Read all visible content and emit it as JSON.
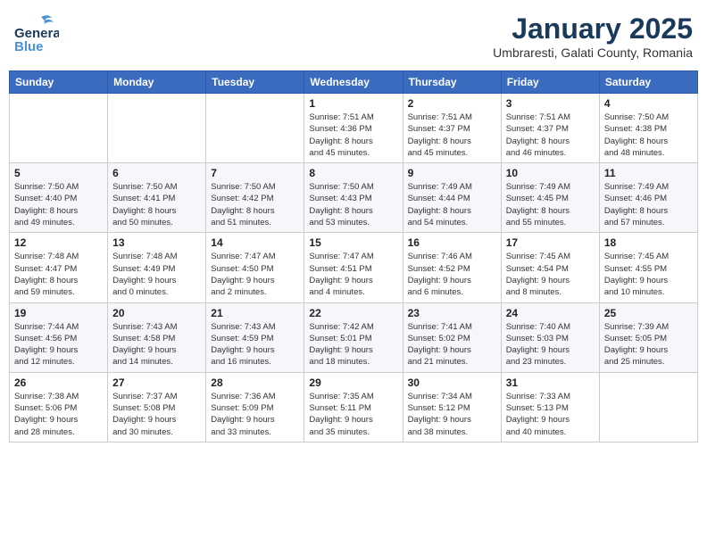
{
  "header": {
    "logo_line1": "General",
    "logo_line2": "Blue",
    "month_title": "January 2025",
    "subtitle": "Umbraresti, Galati County, Romania"
  },
  "weekdays": [
    "Sunday",
    "Monday",
    "Tuesday",
    "Wednesday",
    "Thursday",
    "Friday",
    "Saturday"
  ],
  "weeks": [
    [
      {
        "day": "",
        "info": ""
      },
      {
        "day": "",
        "info": ""
      },
      {
        "day": "",
        "info": ""
      },
      {
        "day": "1",
        "info": "Sunrise: 7:51 AM\nSunset: 4:36 PM\nDaylight: 8 hours\nand 45 minutes."
      },
      {
        "day": "2",
        "info": "Sunrise: 7:51 AM\nSunset: 4:37 PM\nDaylight: 8 hours\nand 45 minutes."
      },
      {
        "day": "3",
        "info": "Sunrise: 7:51 AM\nSunset: 4:37 PM\nDaylight: 8 hours\nand 46 minutes."
      },
      {
        "day": "4",
        "info": "Sunrise: 7:50 AM\nSunset: 4:38 PM\nDaylight: 8 hours\nand 48 minutes."
      }
    ],
    [
      {
        "day": "5",
        "info": "Sunrise: 7:50 AM\nSunset: 4:40 PM\nDaylight: 8 hours\nand 49 minutes."
      },
      {
        "day": "6",
        "info": "Sunrise: 7:50 AM\nSunset: 4:41 PM\nDaylight: 8 hours\nand 50 minutes."
      },
      {
        "day": "7",
        "info": "Sunrise: 7:50 AM\nSunset: 4:42 PM\nDaylight: 8 hours\nand 51 minutes."
      },
      {
        "day": "8",
        "info": "Sunrise: 7:50 AM\nSunset: 4:43 PM\nDaylight: 8 hours\nand 53 minutes."
      },
      {
        "day": "9",
        "info": "Sunrise: 7:49 AM\nSunset: 4:44 PM\nDaylight: 8 hours\nand 54 minutes."
      },
      {
        "day": "10",
        "info": "Sunrise: 7:49 AM\nSunset: 4:45 PM\nDaylight: 8 hours\nand 55 minutes."
      },
      {
        "day": "11",
        "info": "Sunrise: 7:49 AM\nSunset: 4:46 PM\nDaylight: 8 hours\nand 57 minutes."
      }
    ],
    [
      {
        "day": "12",
        "info": "Sunrise: 7:48 AM\nSunset: 4:47 PM\nDaylight: 8 hours\nand 59 minutes."
      },
      {
        "day": "13",
        "info": "Sunrise: 7:48 AM\nSunset: 4:49 PM\nDaylight: 9 hours\nand 0 minutes."
      },
      {
        "day": "14",
        "info": "Sunrise: 7:47 AM\nSunset: 4:50 PM\nDaylight: 9 hours\nand 2 minutes."
      },
      {
        "day": "15",
        "info": "Sunrise: 7:47 AM\nSunset: 4:51 PM\nDaylight: 9 hours\nand 4 minutes."
      },
      {
        "day": "16",
        "info": "Sunrise: 7:46 AM\nSunset: 4:52 PM\nDaylight: 9 hours\nand 6 minutes."
      },
      {
        "day": "17",
        "info": "Sunrise: 7:45 AM\nSunset: 4:54 PM\nDaylight: 9 hours\nand 8 minutes."
      },
      {
        "day": "18",
        "info": "Sunrise: 7:45 AM\nSunset: 4:55 PM\nDaylight: 9 hours\nand 10 minutes."
      }
    ],
    [
      {
        "day": "19",
        "info": "Sunrise: 7:44 AM\nSunset: 4:56 PM\nDaylight: 9 hours\nand 12 minutes."
      },
      {
        "day": "20",
        "info": "Sunrise: 7:43 AM\nSunset: 4:58 PM\nDaylight: 9 hours\nand 14 minutes."
      },
      {
        "day": "21",
        "info": "Sunrise: 7:43 AM\nSunset: 4:59 PM\nDaylight: 9 hours\nand 16 minutes."
      },
      {
        "day": "22",
        "info": "Sunrise: 7:42 AM\nSunset: 5:01 PM\nDaylight: 9 hours\nand 18 minutes."
      },
      {
        "day": "23",
        "info": "Sunrise: 7:41 AM\nSunset: 5:02 PM\nDaylight: 9 hours\nand 21 minutes."
      },
      {
        "day": "24",
        "info": "Sunrise: 7:40 AM\nSunset: 5:03 PM\nDaylight: 9 hours\nand 23 minutes."
      },
      {
        "day": "25",
        "info": "Sunrise: 7:39 AM\nSunset: 5:05 PM\nDaylight: 9 hours\nand 25 minutes."
      }
    ],
    [
      {
        "day": "26",
        "info": "Sunrise: 7:38 AM\nSunset: 5:06 PM\nDaylight: 9 hours\nand 28 minutes."
      },
      {
        "day": "27",
        "info": "Sunrise: 7:37 AM\nSunset: 5:08 PM\nDaylight: 9 hours\nand 30 minutes."
      },
      {
        "day": "28",
        "info": "Sunrise: 7:36 AM\nSunset: 5:09 PM\nDaylight: 9 hours\nand 33 minutes."
      },
      {
        "day": "29",
        "info": "Sunrise: 7:35 AM\nSunset: 5:11 PM\nDaylight: 9 hours\nand 35 minutes."
      },
      {
        "day": "30",
        "info": "Sunrise: 7:34 AM\nSunset: 5:12 PM\nDaylight: 9 hours\nand 38 minutes."
      },
      {
        "day": "31",
        "info": "Sunrise: 7:33 AM\nSunset: 5:13 PM\nDaylight: 9 hours\nand 40 minutes."
      },
      {
        "day": "",
        "info": ""
      }
    ]
  ]
}
